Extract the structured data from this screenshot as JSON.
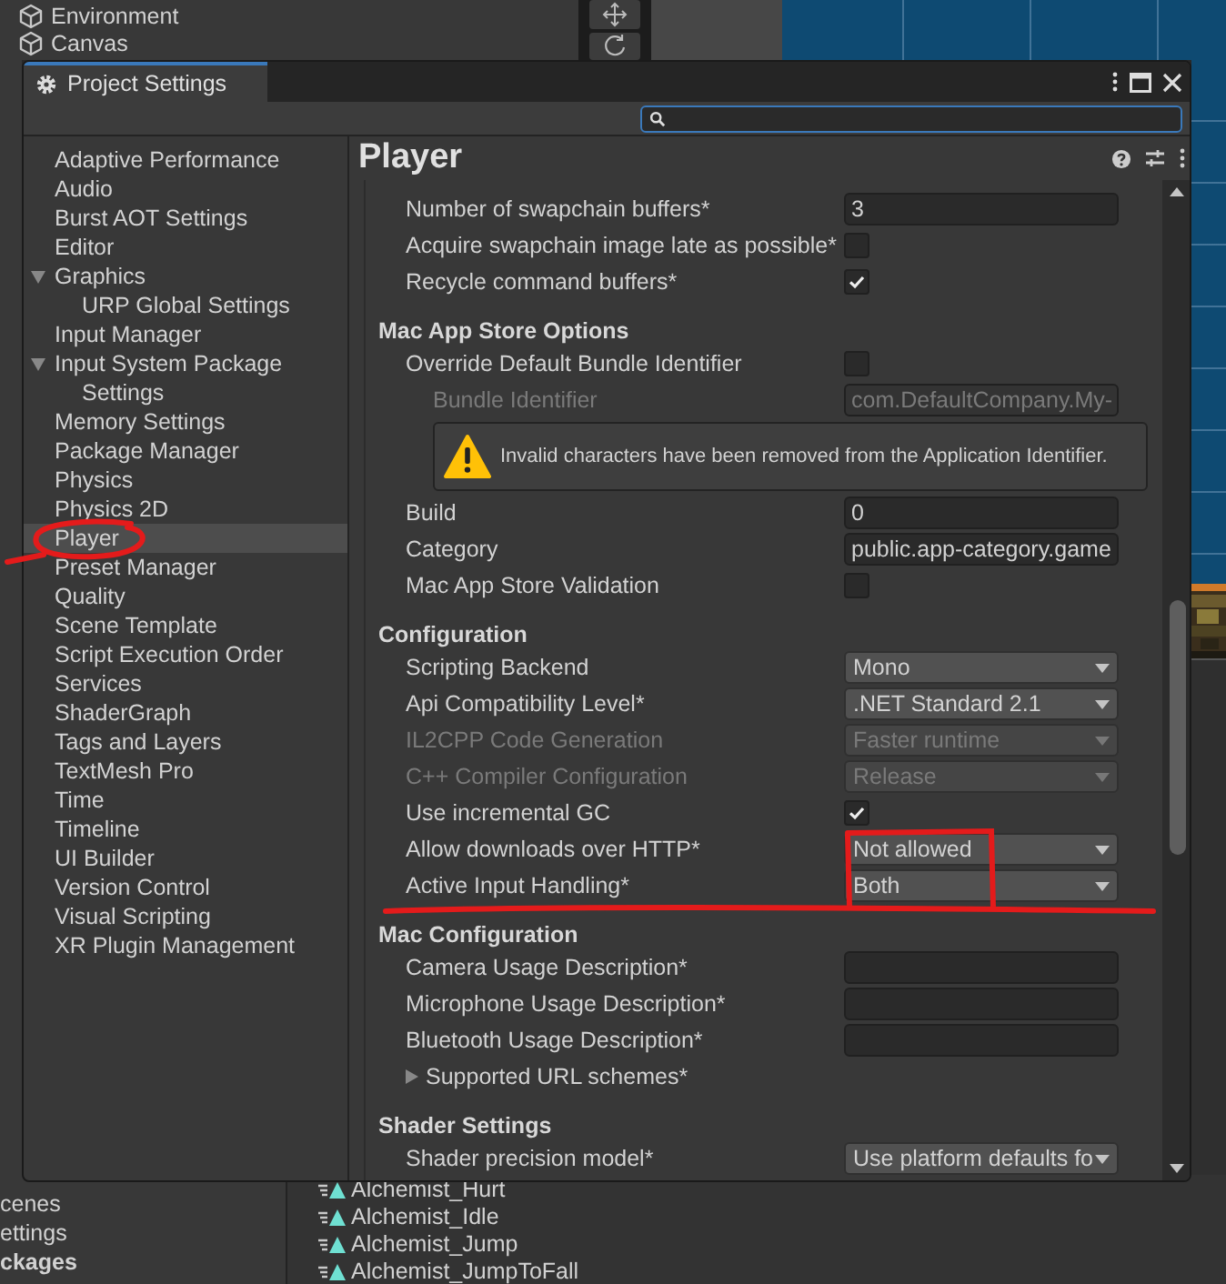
{
  "background": {
    "hierarchy": [
      {
        "label": "Environment"
      },
      {
        "label": "Canvas"
      }
    ],
    "project_folders": [
      {
        "label": "cenes",
        "bold": false
      },
      {
        "label": "ettings",
        "bold": false
      },
      {
        "label": "ckages",
        "bold": true
      }
    ],
    "assets": [
      "Alchemist_Hurt",
      "Alchemist_Idle",
      "Alchemist_Jump",
      "Alchemist_JumpToFall"
    ]
  },
  "window": {
    "title": "Project Settings"
  },
  "sidebar": {
    "items": [
      {
        "label": "Adaptive Performance",
        "selected": false
      },
      {
        "label": "Audio",
        "selected": false
      },
      {
        "label": "Burst AOT Settings",
        "selected": false
      },
      {
        "label": "Editor",
        "selected": false
      },
      {
        "label": "Graphics",
        "selected": false,
        "expanded": true,
        "children": [
          {
            "label": "URP Global Settings",
            "selected": false
          }
        ]
      },
      {
        "label": "Input Manager",
        "selected": false
      },
      {
        "label": "Input System Package",
        "selected": false,
        "expanded": true,
        "children": [
          {
            "label": "Settings",
            "selected": false
          }
        ]
      },
      {
        "label": "Memory Settings",
        "selected": false
      },
      {
        "label": "Package Manager",
        "selected": false
      },
      {
        "label": "Physics",
        "selected": false
      },
      {
        "label": "Physics 2D",
        "selected": false
      },
      {
        "label": "Player",
        "selected": true
      },
      {
        "label": "Preset Manager",
        "selected": false
      },
      {
        "label": "Quality",
        "selected": false
      },
      {
        "label": "Scene Template",
        "selected": false
      },
      {
        "label": "Script Execution Order",
        "selected": false
      },
      {
        "label": "Services",
        "selected": false
      },
      {
        "label": "ShaderGraph",
        "selected": false
      },
      {
        "label": "Tags and Layers",
        "selected": false
      },
      {
        "label": "TextMesh Pro",
        "selected": false
      },
      {
        "label": "Time",
        "selected": false
      },
      {
        "label": "Timeline",
        "selected": false
      },
      {
        "label": "UI Builder",
        "selected": false
      },
      {
        "label": "Version Control",
        "selected": false
      },
      {
        "label": "Visual Scripting",
        "selected": false
      },
      {
        "label": "XR Plugin Management",
        "selected": false
      }
    ]
  },
  "page": {
    "title": "Player",
    "sections": [
      {
        "rows": [
          {
            "kind": "text",
            "label": "Number of swapchain buffers*",
            "value": "3",
            "disabled": false
          },
          {
            "kind": "checkbox",
            "label": "Acquire swapchain image late as possible*",
            "checked": false,
            "disabled": false
          },
          {
            "kind": "checkbox",
            "label": "Recycle command buffers*",
            "checked": true,
            "disabled": false
          }
        ]
      },
      {
        "title": "Mac App Store Options",
        "rows": [
          {
            "kind": "checkbox",
            "label": "Override Default Bundle Identifier",
            "checked": false,
            "disabled": false,
            "children": [
              {
                "kind": "text",
                "label": "Bundle Identifier",
                "value": "com.DefaultCompany.My-",
                "disabled": true
              },
              {
                "kind": "warning",
                "text": "Invalid characters have been removed from the Application Identifier."
              }
            ]
          },
          {
            "kind": "text",
            "label": "Build",
            "value": "0",
            "disabled": false
          },
          {
            "kind": "text",
            "label": "Category",
            "value": "public.app-category.game",
            "disabled": false
          },
          {
            "kind": "checkbox",
            "label": "Mac App Store Validation",
            "checked": false,
            "disabled": false
          }
        ]
      },
      {
        "title": "Configuration",
        "rows": [
          {
            "kind": "dropdown",
            "label": "Scripting Backend",
            "value": "Mono",
            "disabled": false
          },
          {
            "kind": "dropdown",
            "label": "Api Compatibility Level*",
            "value": ".NET Standard 2.1",
            "disabled": false
          },
          {
            "kind": "dropdown",
            "label": "IL2CPP Code Generation",
            "value": "Faster runtime",
            "disabled": true
          },
          {
            "kind": "dropdown",
            "label": "C++ Compiler Configuration",
            "value": "Release",
            "disabled": true
          },
          {
            "kind": "checkbox",
            "label": "Use incremental GC",
            "checked": true,
            "disabled": false
          },
          {
            "kind": "dropdown",
            "label": "Allow downloads over HTTP*",
            "value": "Not allowed",
            "disabled": false
          },
          {
            "kind": "dropdown",
            "label": "Active Input Handling*",
            "value": "Both",
            "disabled": false
          }
        ]
      },
      {
        "title": "Mac Configuration",
        "rows": [
          {
            "kind": "text",
            "label": "Camera Usage Description*",
            "disabled": false
          },
          {
            "kind": "text",
            "label": "Microphone Usage Description*",
            "disabled": false
          },
          {
            "kind": "text",
            "label": "Bluetooth Usage Description*",
            "disabled": false
          },
          {
            "kind": "foldout",
            "label": "Supported URL schemes*",
            "expanded": false
          }
        ]
      },
      {
        "title": "Shader Settings",
        "rows": [
          {
            "kind": "dropdown",
            "label": "Shader precision model*",
            "value": "Use platform defaults fo",
            "disabled": false
          }
        ]
      }
    ]
  },
  "annotations": [
    {
      "kind": "circle"
    },
    {
      "kind": "box"
    },
    {
      "kind": "underline"
    }
  ]
}
